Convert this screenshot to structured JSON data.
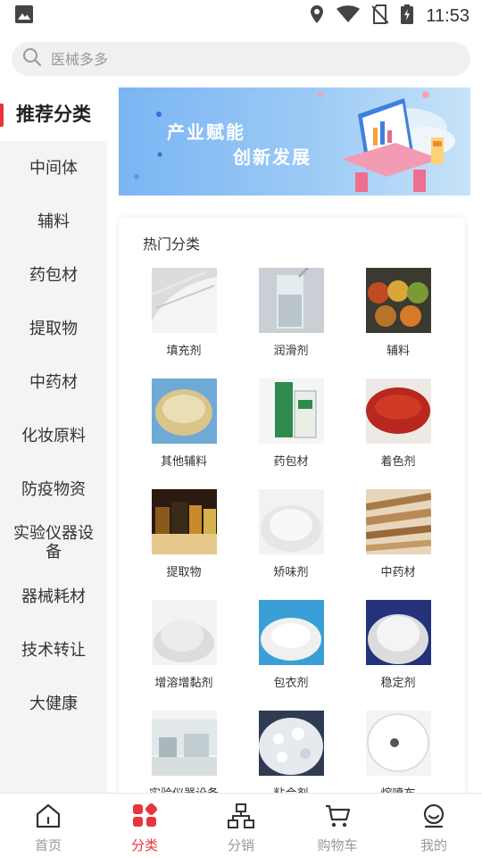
{
  "status": {
    "time": "11:53"
  },
  "search": {
    "placeholder": "医械多多"
  },
  "sidebar": {
    "items": [
      {
        "label": "推荐分类",
        "active": true
      },
      {
        "label": "中间体"
      },
      {
        "label": "辅料"
      },
      {
        "label": "药包材"
      },
      {
        "label": "提取物"
      },
      {
        "label": "中药材"
      },
      {
        "label": "化妆原料"
      },
      {
        "label": "防疫物资"
      },
      {
        "label": "实验仪器设备"
      },
      {
        "label": "器械耗材"
      },
      {
        "label": "技术转让"
      },
      {
        "label": "大健康"
      }
    ]
  },
  "banner": {
    "line1": "产业赋能",
    "line2": "创新发展"
  },
  "hot": {
    "title": "热门分类",
    "items": [
      {
        "label": "填充剂",
        "img": "white-powder"
      },
      {
        "label": "润滑剂",
        "img": "liquid-glass"
      },
      {
        "label": "辅料",
        "img": "jars"
      },
      {
        "label": "其他辅料",
        "img": "powder-bowl"
      },
      {
        "label": "药包材",
        "img": "package-box"
      },
      {
        "label": "着色剂",
        "img": "red-powder"
      },
      {
        "label": "提取物",
        "img": "bottles"
      },
      {
        "label": "矫味剂",
        "img": "white-powder-pile"
      },
      {
        "label": "中药材",
        "img": "herb-roots"
      },
      {
        "label": "增溶增黏剂",
        "img": "powder-pile"
      },
      {
        "label": "包衣剂",
        "img": "powder-blue"
      },
      {
        "label": "稳定剂",
        "img": "powder-dark"
      },
      {
        "label": "实验仪器设备",
        "img": "lab-room"
      },
      {
        "label": "粘合剂",
        "img": "crystals"
      },
      {
        "label": "熔喷布",
        "img": "fabric-roll"
      }
    ]
  },
  "tabs": [
    {
      "label": "首页",
      "icon": "home-icon"
    },
    {
      "label": "分类",
      "icon": "category-icon",
      "active": true
    },
    {
      "label": "分销",
      "icon": "distribution-icon"
    },
    {
      "label": "购物车",
      "icon": "cart-icon"
    },
    {
      "label": "我的",
      "icon": "profile-icon"
    }
  ],
  "colors": {
    "accent": "#e8353b",
    "sidebar_bg": "#f4f4f4"
  }
}
